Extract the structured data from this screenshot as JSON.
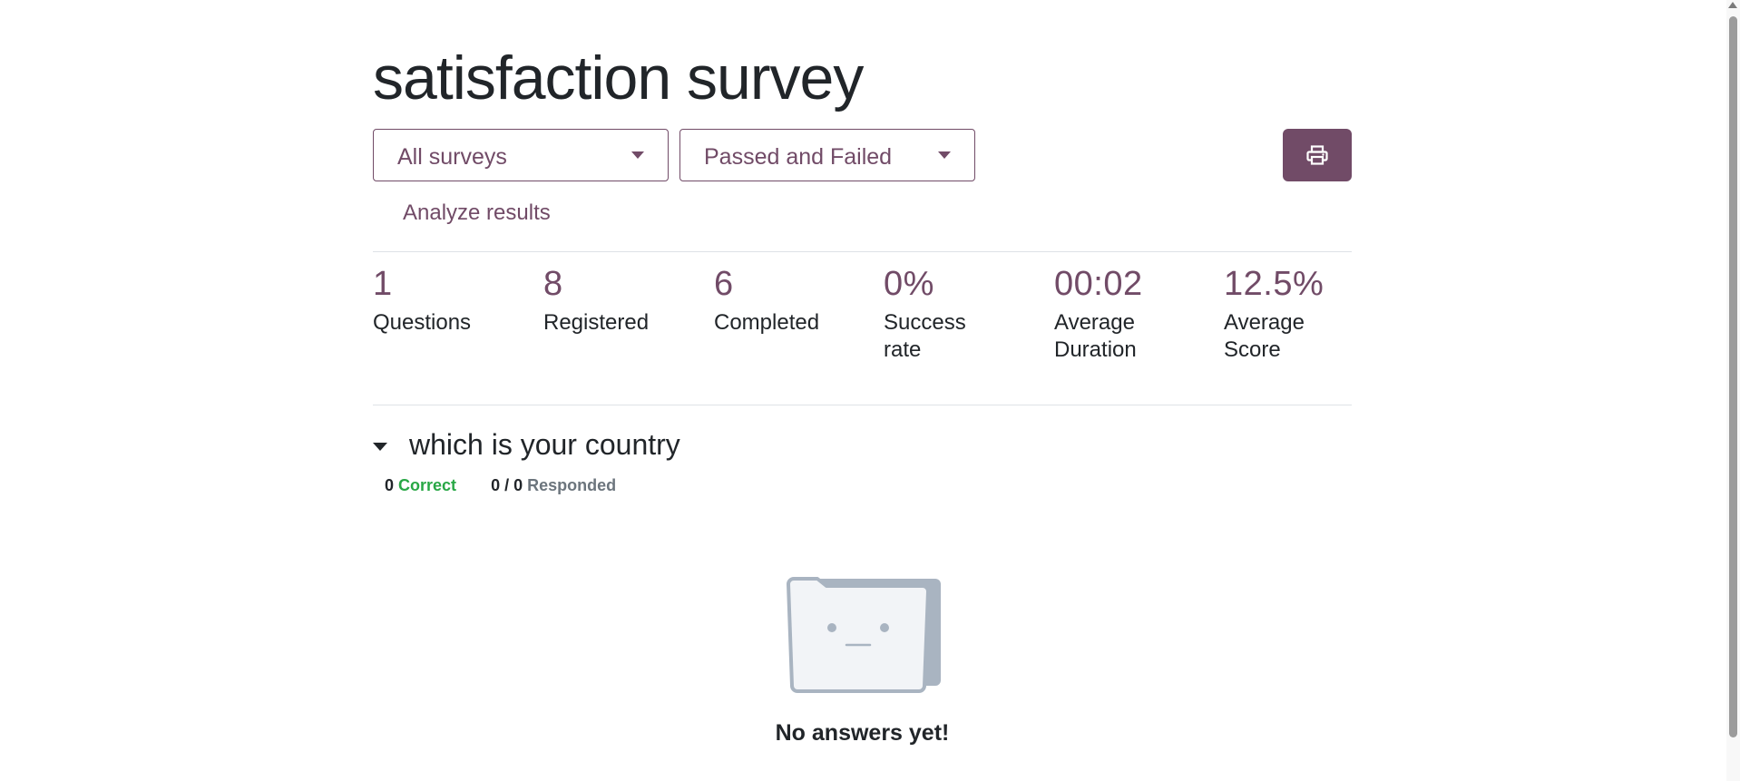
{
  "page": {
    "title": "satisfaction survey"
  },
  "filters": {
    "survey_select": "All surveys",
    "result_select": "Passed and Failed",
    "print_icon": "printer-icon"
  },
  "tabs": {
    "analyze": "Analyze results"
  },
  "stats": [
    {
      "value": "1",
      "label": "Questions"
    },
    {
      "value": "8",
      "label": "Registered"
    },
    {
      "value": "6",
      "label": "Completed"
    },
    {
      "value": "0%",
      "label": "Success rate"
    },
    {
      "value": "00:02",
      "label": "Average Duration"
    },
    {
      "value": "12.5%",
      "label": "Average Score"
    }
  ],
  "question": {
    "title": "which is your country",
    "correct_count": "0",
    "correct_label": "Correct",
    "responded_count": "0 / 0",
    "responded_label": "Responded"
  },
  "empty_state": {
    "icon": "empty-folder-icon",
    "message": "No answers yet!"
  },
  "colors": {
    "accent": "#714b67",
    "correct": "#28a745",
    "muted": "#6c757d"
  }
}
